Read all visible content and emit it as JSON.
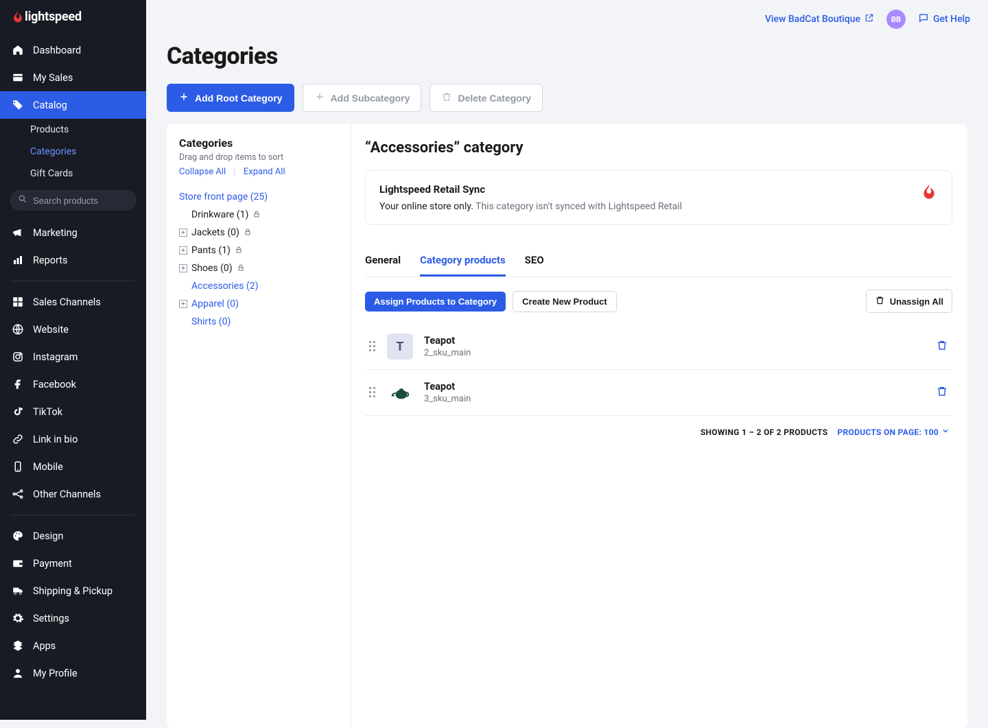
{
  "brand": {
    "name": "lightspeed",
    "accent": "#E53935"
  },
  "topbar": {
    "viewStore": "View BadCat Boutique",
    "avatar": "BB",
    "help": "Get Help"
  },
  "sidebar": {
    "items": [
      {
        "label": "Dashboard",
        "icon": "home"
      },
      {
        "label": "My Sales",
        "icon": "card"
      },
      {
        "label": "Catalog",
        "icon": "tag",
        "active": true,
        "children": [
          {
            "label": "Products"
          },
          {
            "label": "Categories",
            "active": true
          },
          {
            "label": "Gift Cards"
          }
        ]
      }
    ],
    "searchPlaceholder": "Search products",
    "groups": [
      [
        {
          "label": "Marketing",
          "icon": "megaphone"
        },
        {
          "label": "Reports",
          "icon": "bars"
        }
      ],
      [
        {
          "label": "Sales Channels",
          "icon": "windows"
        },
        {
          "label": "Website",
          "icon": "globe"
        },
        {
          "label": "Instagram",
          "icon": "instagram"
        },
        {
          "label": "Facebook",
          "icon": "facebook"
        },
        {
          "label": "TikTok",
          "icon": "tiktok"
        },
        {
          "label": "Link in bio",
          "icon": "link"
        },
        {
          "label": "Mobile",
          "icon": "mobile"
        },
        {
          "label": "Other Channels",
          "icon": "nodes"
        }
      ],
      [
        {
          "label": "Design",
          "icon": "palette"
        },
        {
          "label": "Payment",
          "icon": "wallet"
        },
        {
          "label": "Shipping & Pickup",
          "icon": "truck"
        },
        {
          "label": "Settings",
          "icon": "gear"
        },
        {
          "label": "Apps",
          "icon": "apps"
        },
        {
          "label": "My Profile",
          "icon": "user"
        }
      ]
    ]
  },
  "page": {
    "title": "Categories",
    "buttons": {
      "addRoot": "Add Root Category",
      "addSub": "Add Subcategory",
      "delete": "Delete Category"
    }
  },
  "tree": {
    "title": "Categories",
    "help": "Drag and drop items to sort",
    "collapse": "Collapse All",
    "expand": "Expand All",
    "root": "Store front page (25)",
    "items": [
      {
        "label": "Drinkware (1)",
        "locked": true,
        "expandable": false,
        "link": false
      },
      {
        "label": "Jackets (0)",
        "locked": true,
        "expandable": true,
        "link": false
      },
      {
        "label": "Pants (1)",
        "locked": true,
        "expandable": true,
        "link": false
      },
      {
        "label": "Shoes (0)",
        "locked": true,
        "expandable": true,
        "link": false
      },
      {
        "label": "Accessories (2)",
        "locked": false,
        "expandable": false,
        "link": true,
        "selected": true
      },
      {
        "label": "Apparel (0)",
        "locked": false,
        "expandable": true,
        "link": true
      },
      {
        "label": "Shirts (0)",
        "locked": false,
        "expandable": false,
        "link": true
      }
    ]
  },
  "detail": {
    "title": "“Accessories” category",
    "sync": {
      "title": "Lightspeed Retail Sync",
      "lead": "Your online store only.",
      "rest": " This category isn't synced with Lightspeed Retail"
    },
    "tabs": {
      "general": "General",
      "products": "Category products",
      "seo": "SEO"
    },
    "buttons": {
      "assign": "Assign Products to Category",
      "create": "Create New Product",
      "unassign": "Unassign All"
    },
    "products": [
      {
        "name": "Teapot",
        "sku": "2_sku_main",
        "thumb": "T"
      },
      {
        "name": "Teapot",
        "sku": "3_sku_main",
        "thumb": "teapot-image"
      }
    ],
    "pager": {
      "showing": "SHOWING 1 – 2 OF 2 PRODUCTS",
      "perPage": "PRODUCTS ON PAGE: 100"
    }
  }
}
